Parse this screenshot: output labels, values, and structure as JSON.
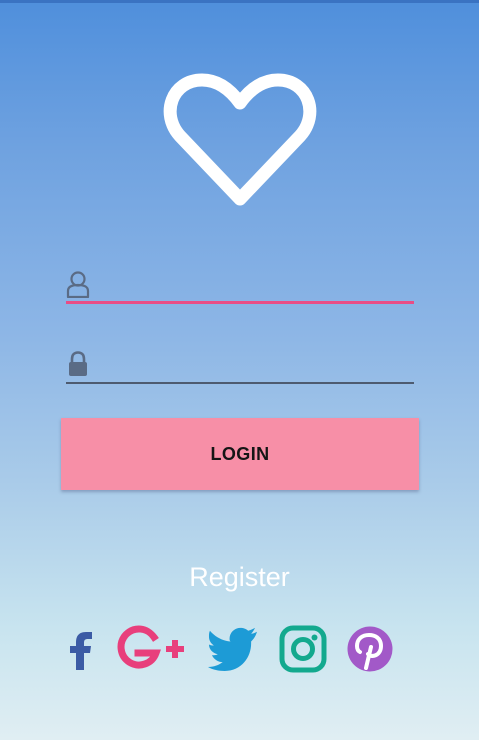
{
  "login": {
    "username_value": "",
    "password_value": "",
    "button_label": "LOGIN"
  },
  "register_label": "Register",
  "icons": {
    "logo": "heart-outline-icon",
    "username": "user-icon",
    "password": "lock-icon",
    "social": [
      "facebook-icon",
      "google-plus-icon",
      "twitter-icon",
      "instagram-icon",
      "pinterest-icon"
    ]
  },
  "colors": {
    "accent": "#e84d86",
    "button": "#f78fa7",
    "facebook": "#3b5ba5",
    "google_plus": "#e83f7c",
    "twitter": "#1d9bd6",
    "instagram": "#13a98e",
    "pinterest": "#a259c8"
  }
}
